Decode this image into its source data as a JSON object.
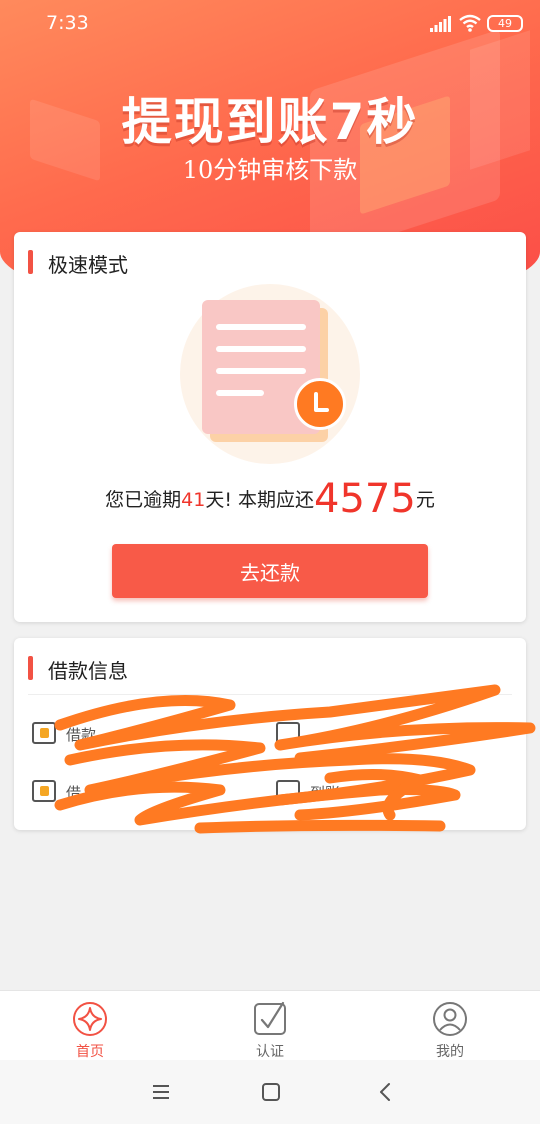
{
  "status_bar": {
    "time": "7:33",
    "battery": "49"
  },
  "banner": {
    "title": "提现到账7秒",
    "subtitle": "10分钟审核下款"
  },
  "fast_mode": {
    "title": "极速模式",
    "overdue_prefix": "您已逾期",
    "overdue_days": "41",
    "overdue_middle": "天! 本期应还",
    "amount_due": "4575",
    "currency_unit": "元",
    "repay_label": "去还款"
  },
  "loan_info": {
    "title": "借款信息",
    "items": [
      {
        "label": "借款",
        "icon": "id-card-icon"
      },
      {
        "label": "",
        "icon": "card-icon"
      },
      {
        "label": "借",
        "icon": "id-card-icon"
      },
      {
        "label": "到账",
        "icon": "card-icon"
      }
    ]
  },
  "tabs": [
    {
      "label": "首页",
      "icon": "home-diamond-icon",
      "active": true
    },
    {
      "label": "认证",
      "icon": "checkmark-square-icon",
      "active": false
    },
    {
      "label": "我的",
      "icon": "user-icon",
      "active": false
    }
  ],
  "colors": {
    "accent": "#f25244",
    "amount": "#f0352b",
    "button": "#f85a48",
    "scribble": "#ff7a22"
  }
}
